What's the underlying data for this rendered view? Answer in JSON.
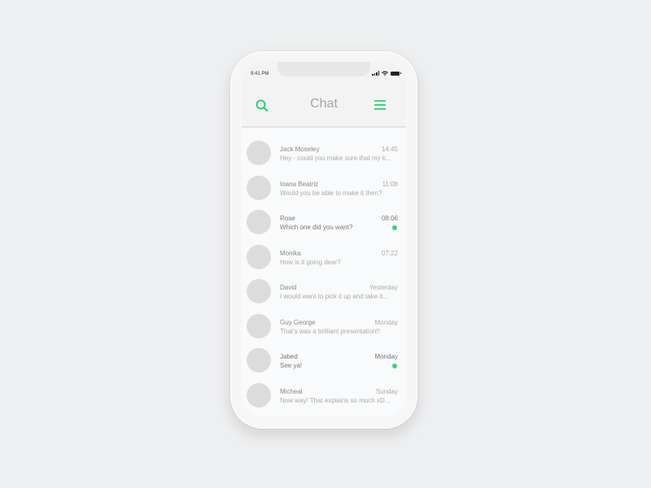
{
  "status_bar": {
    "time": "9:41 PM"
  },
  "header": {
    "title": "Chat"
  },
  "icons": {
    "search": "search-icon",
    "menu": "hamburger-menu-icon",
    "signal": "signal-icon",
    "wifi": "wifi-icon",
    "battery": "battery-icon"
  },
  "colors": {
    "accent": "#2ecc71",
    "unread_dot": "#3ed07a",
    "avatar": "#dcdcdc"
  },
  "conversations": [
    {
      "name": "Jack Moseley",
      "time": "14:45",
      "preview": "Hey - could you make sure that my k...",
      "unread": false
    },
    {
      "name": "Ioana Beatriz",
      "time": "11:08",
      "preview": "Would you be able to make it then?",
      "unread": false
    },
    {
      "name": "Rose",
      "time": "08:06",
      "preview": "Which one did you want?",
      "unread": true
    },
    {
      "name": "Monika",
      "time": "07:22",
      "preview": "How is it going dear?",
      "unread": false
    },
    {
      "name": "David",
      "time": "Yesterday",
      "preview": "I would want to pick it up and take it...",
      "unread": false
    },
    {
      "name": "Guy George",
      "time": "Monday",
      "preview": "That's was a brilliant presentation!!",
      "unread": false
    },
    {
      "name": "Jabed",
      "time": "Monday",
      "preview": "See ya!",
      "unread": true
    },
    {
      "name": "Micheal",
      "time": "Sunday",
      "preview": "Now way! That explains so much xD...",
      "unread": false
    }
  ]
}
